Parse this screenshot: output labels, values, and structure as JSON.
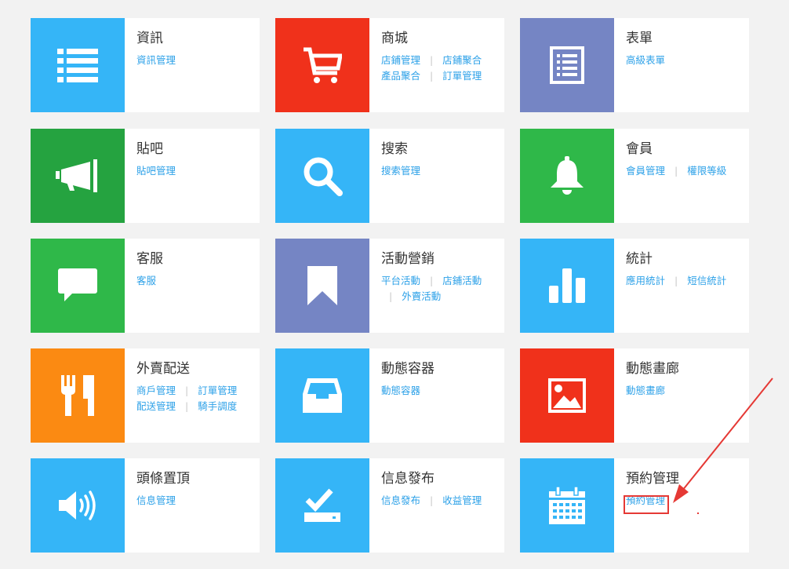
{
  "colors": {
    "blue": "#35b5f7",
    "red": "#f0311b",
    "purple": "#7585c4",
    "dark_green": "#25a340",
    "green": "#2fb849",
    "orange": "#fb8a12",
    "link": "#2da1e8",
    "annotation": "#e53935"
  },
  "modules": {
    "news": {
      "title": "資訊",
      "icon": "list-icon",
      "links": [
        "資訊管理"
      ]
    },
    "mall": {
      "title": "商城",
      "icon": "shopping-cart-icon",
      "links": [
        "店鋪管理",
        "店鋪聚合",
        "產品聚合",
        "訂單管理"
      ]
    },
    "form": {
      "title": "表單",
      "icon": "form-icon",
      "links": [
        "高級表單"
      ]
    },
    "forum": {
      "title": "貼吧",
      "icon": "megaphone-icon",
      "links": [
        "貼吧管理"
      ]
    },
    "search": {
      "title": "搜索",
      "icon": "search-icon",
      "links": [
        "搜索管理"
      ]
    },
    "member": {
      "title": "會員",
      "icon": "bell-icon",
      "links": [
        "會員管理",
        "權限等級"
      ]
    },
    "service": {
      "title": "客服",
      "icon": "chat-bubble-icon",
      "links": [
        "客服"
      ]
    },
    "marketing": {
      "title": "活動營銷",
      "icon": "bookmark-icon",
      "links": [
        "平台活動",
        "店鋪活動",
        "外賣活動"
      ]
    },
    "stats": {
      "title": "統計",
      "icon": "bar-chart-icon",
      "links": [
        "應用統計",
        "短信統計"
      ]
    },
    "delivery": {
      "title": "外賣配送",
      "icon": "fork-knife-icon",
      "links": [
        "商戶管理",
        "訂單管理",
        "配送管理",
        "騎手調度"
      ]
    },
    "container": {
      "title": "動態容器",
      "icon": "inbox-tray-icon",
      "links": [
        "動態容器"
      ]
    },
    "gallery": {
      "title": "動態畫廊",
      "icon": "image-icon",
      "links": [
        "動態畫廊"
      ]
    },
    "headline": {
      "title": "頭條置頂",
      "icon": "speaker-icon",
      "links": [
        "信息管理"
      ]
    },
    "publish": {
      "title": "信息發布",
      "icon": "check-tray-icon",
      "links": [
        "信息發布",
        "收益管理"
      ]
    },
    "booking": {
      "title": "預約管理",
      "icon": "calendar-icon",
      "links": [
        "預約管理"
      ]
    }
  }
}
